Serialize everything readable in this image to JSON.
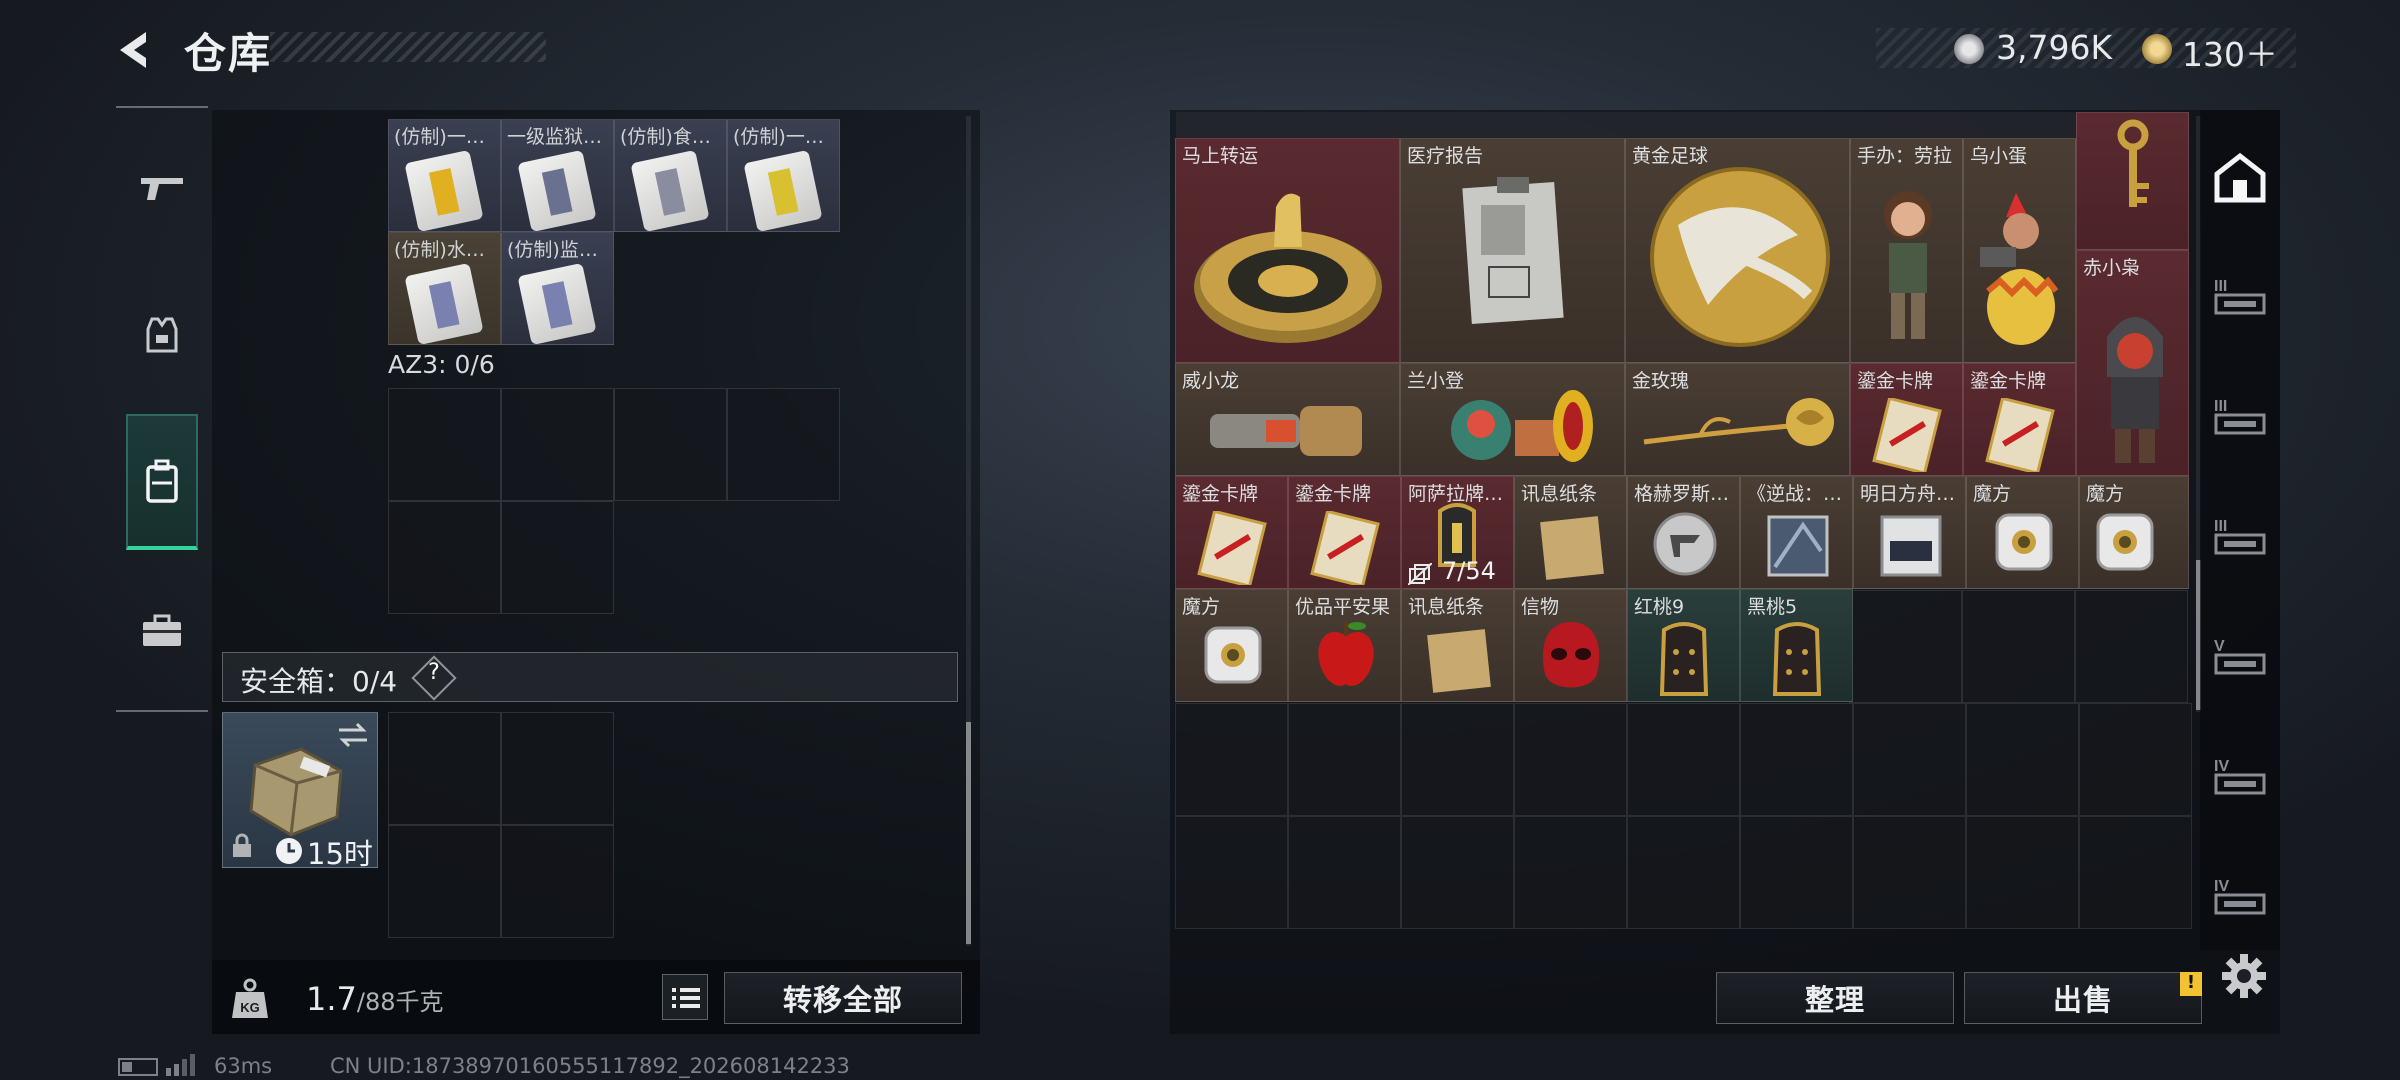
{
  "header": {
    "title": "仓库"
  },
  "currency": {
    "coins_value": "3,796K",
    "gold_value": "130＋"
  },
  "left_nav": {
    "items": [
      {
        "name": "weapons",
        "icon": "gun-icon"
      },
      {
        "name": "armor",
        "icon": "vest-icon"
      },
      {
        "name": "backpack",
        "icon": "backpack-icon",
        "active": true
      },
      {
        "name": "case",
        "icon": "briefcase-icon"
      }
    ]
  },
  "left_panel": {
    "items": [
      {
        "label": "(仿制)一…"
      },
      {
        "label": "一级监狱…"
      },
      {
        "label": "(仿制)食…"
      },
      {
        "label": "(仿制)一…"
      },
      {
        "label": "(仿制)水…"
      },
      {
        "label": "(仿制)监…"
      }
    ],
    "az3_label": "AZ3: 0/6",
    "safe_label": "安全箱：0/4",
    "help": "?",
    "safe_timer": "15时",
    "weight_value": "1.7",
    "weight_max": "/88千克",
    "kg_label": "KG",
    "transfer_all": "转移全部"
  },
  "right_panel": {
    "items": [
      {
        "label": "马上转运"
      },
      {
        "label": "医疗报告"
      },
      {
        "label": "黄金足球"
      },
      {
        "label": "手办：劳拉"
      },
      {
        "label": "乌小蛋"
      },
      {
        "label": "赤小枭"
      },
      {
        "label": "威小龙"
      },
      {
        "label": "兰小登"
      },
      {
        "label": "金玫瑰"
      },
      {
        "label": "鎏金卡牌"
      },
      {
        "label": "鎏金卡牌"
      },
      {
        "label": "鎏金卡牌"
      },
      {
        "label": "鎏金卡牌"
      },
      {
        "label": "阿萨拉牌…"
      },
      {
        "label": "讯息纸条"
      },
      {
        "label": "格赫罗斯…"
      },
      {
        "label": "《逆战：…"
      },
      {
        "label": "明日方舟…"
      },
      {
        "label": "魔方"
      },
      {
        "label": "魔方"
      },
      {
        "label": "魔方"
      },
      {
        "label": "优品平安果"
      },
      {
        "label": "讯息纸条"
      },
      {
        "label": "信物"
      },
      {
        "label": "红桃9"
      },
      {
        "label": "黑桃5"
      }
    ],
    "asala_count": "7/54",
    "sort_button": "整理",
    "sell_button": "出售",
    "warn": "!"
  },
  "right_tabs": {
    "items": [
      {
        "icon": "house-icon"
      },
      {
        "tier": "III"
      },
      {
        "tier": "III"
      },
      {
        "tier": "III"
      },
      {
        "tier": "V"
      },
      {
        "tier": "IV"
      },
      {
        "tier": "IV"
      }
    ]
  },
  "status": {
    "ping": "63ms",
    "uid": "CN UID:18738970160555117892_202608142233"
  }
}
